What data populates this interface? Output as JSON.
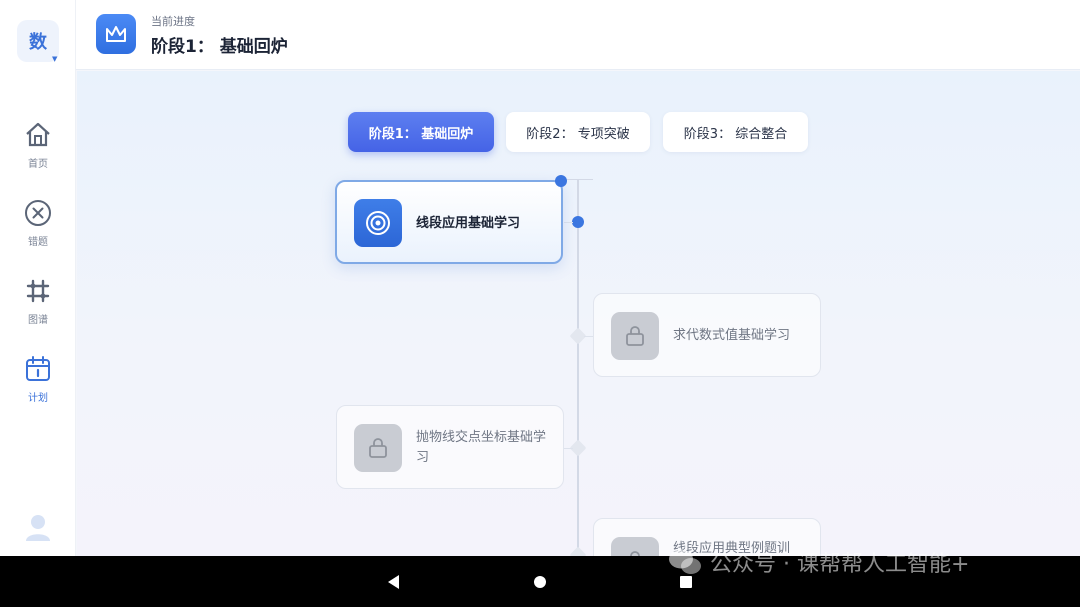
{
  "sidebar": {
    "subject_badge": "数",
    "items": [
      {
        "label": "首页",
        "icon": "home-icon"
      },
      {
        "label": "错题",
        "icon": "x-circle-icon"
      },
      {
        "label": "图谱",
        "icon": "graph-icon"
      },
      {
        "label": "计划",
        "icon": "calendar-icon"
      }
    ],
    "active_item": "计划"
  },
  "header": {
    "subtitle": "当前进度",
    "title": "阶段1： 基础回炉",
    "icon": "mountain-icon"
  },
  "stage_tabs": [
    {
      "label": "阶段1： 基础回炉",
      "active": true
    },
    {
      "label": "阶段2： 专项突破",
      "active": false
    },
    {
      "label": "阶段3： 综合整合",
      "active": false
    }
  ],
  "roadmap": [
    {
      "label": "线段应用基础学习",
      "status": "active",
      "icon": "target-icon"
    },
    {
      "label": "求代数式值基础学习",
      "status": "locked",
      "icon": "lock-icon"
    },
    {
      "label": "抛物线交点坐标基础学习",
      "status": "locked",
      "icon": "lock-icon"
    },
    {
      "label": "线段应用典型例题训",
      "status": "locked",
      "icon": "lock-icon"
    }
  ],
  "watermark": "公众号 · 课帮帮人工智能+",
  "colors": {
    "accent": "#3b72d9",
    "active_tab": "#4f6fea",
    "locked_icon": "#c9ccd3"
  }
}
